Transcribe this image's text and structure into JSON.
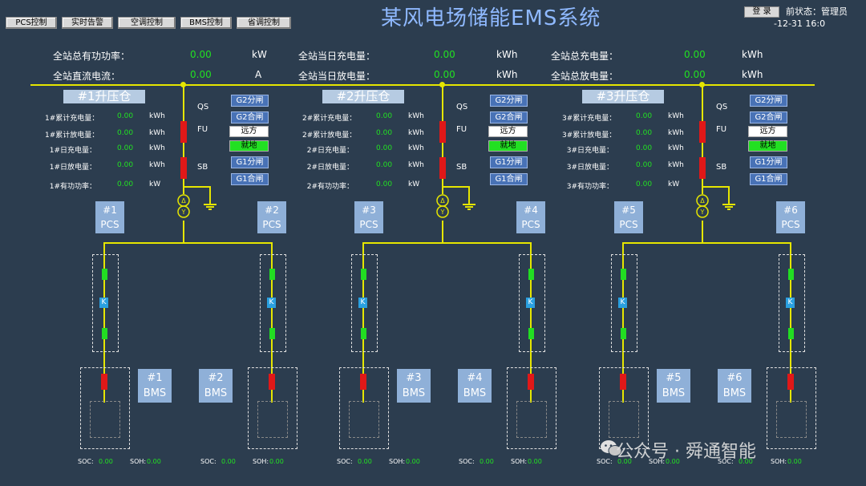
{
  "nav": [
    "PCS控制",
    "实时告警",
    "空调控制",
    "BMS控制",
    "省调控制"
  ],
  "title": "某风电场储能EMS系统",
  "login_label": "登 录",
  "current_state": "前状态：管理员",
  "datetime": "-12-31 16:0",
  "summary": [
    {
      "label": "全站总有功功率：",
      "value": "0.00",
      "unit": "kW"
    },
    {
      "label": "全站直流电流：",
      "value": "0.00",
      "unit": "A"
    },
    {
      "label": "全站当日充电量：",
      "value": "0.00",
      "unit": "kWh"
    },
    {
      "label": "全站当日放电量：",
      "value": "0.00",
      "unit": "kWh"
    },
    {
      "label": "全站总充电量：",
      "value": "0.00",
      "unit": "kWh"
    },
    {
      "label": "全站总放电量：",
      "value": "0.00",
      "unit": "kWh"
    }
  ],
  "stations": [
    {
      "title": "#1升压仓",
      "stats": [
        {
          "label": "1#累计充电量：",
          "value": "0.00",
          "unit": "kWh"
        },
        {
          "label": "1#累计放电量：",
          "value": "0.00",
          "unit": "kWh"
        },
        {
          "label": "1#日充电量：",
          "value": "0.00",
          "unit": "kWh"
        },
        {
          "label": "1#日放电量：",
          "value": "0.00",
          "unit": "kWh"
        },
        {
          "label": "1#有功功率：",
          "value": "0.00",
          "unit": "kW"
        }
      ],
      "pcs": [
        {
          "num": "#1",
          "label": "PCS"
        },
        {
          "num": "#2",
          "label": "PCS"
        }
      ],
      "bms": [
        {
          "num": "#1",
          "label": "BMS"
        },
        {
          "num": "#2",
          "label": "BMS"
        }
      ],
      "soc": [
        {
          "soc": "0.00",
          "soh": "0.00"
        },
        {
          "soc": "0.00",
          "soh": "0.00"
        }
      ]
    },
    {
      "title": "#2升压仓",
      "stats": [
        {
          "label": "2#累计充电量：",
          "value": "0.00",
          "unit": "kWh"
        },
        {
          "label": "2#累计放电量：",
          "value": "0.00",
          "unit": "kWh"
        },
        {
          "label": "2#日充电量：",
          "value": "0.00",
          "unit": "kWh"
        },
        {
          "label": "2#日放电量：",
          "value": "0.00",
          "unit": "kWh"
        },
        {
          "label": "2#有功功率：",
          "value": "0.00",
          "unit": "kW"
        }
      ],
      "pcs": [
        {
          "num": "#3",
          "label": "PCS"
        },
        {
          "num": "#4",
          "label": "PCS"
        }
      ],
      "bms": [
        {
          "num": "#3",
          "label": "BMS"
        },
        {
          "num": "#4",
          "label": "BMS"
        }
      ],
      "soc": [
        {
          "soc": "0.00",
          "soh": "0.00"
        },
        {
          "soc": "0.00",
          "soh": "0.00"
        }
      ]
    },
    {
      "title": "#3升压仓",
      "stats": [
        {
          "label": "3#累计充电量：",
          "value": "0.00",
          "unit": "kWh"
        },
        {
          "label": "3#累计放电量：",
          "value": "0.00",
          "unit": "kWh"
        },
        {
          "label": "3#日充电量：",
          "value": "0.00",
          "unit": "kWh"
        },
        {
          "label": "3#日放电量：",
          "value": "0.00",
          "unit": "kWh"
        },
        {
          "label": "3#有功功率：",
          "value": "0.00",
          "unit": "kW"
        }
      ],
      "pcs": [
        {
          "num": "#5",
          "label": "PCS"
        },
        {
          "num": "#6",
          "label": "PCS"
        }
      ],
      "bms": [
        {
          "num": "#5",
          "label": "BMS"
        },
        {
          "num": "#6",
          "label": "BMS"
        }
      ],
      "soc": [
        {
          "soc": "0.00",
          "soh": "0.00"
        },
        {
          "soc": "0.00",
          "soh": "0.00"
        }
      ]
    }
  ],
  "switch_labels": {
    "qs": "QS",
    "fu": "FU",
    "sb": "SB"
  },
  "controls": {
    "g2_open": "G2分闸",
    "g2_close": "G2合闸",
    "remote": "远方",
    "local": "就地",
    "g1_open": "G1分闸",
    "g1_close": "G1合闸"
  },
  "soc_label": "SOC:",
  "soh_label": "SOH:",
  "k_symbol": "K",
  "watermark": "公众号 · 舜通智能",
  "colors": {
    "background": "#2c3d4f",
    "bus": "#e6e600",
    "value": "#22e022",
    "breaker": "#e01818",
    "switch": "#22dd22",
    "pcs_box": "#8fb0d8",
    "control_button": "#4872b6"
  }
}
